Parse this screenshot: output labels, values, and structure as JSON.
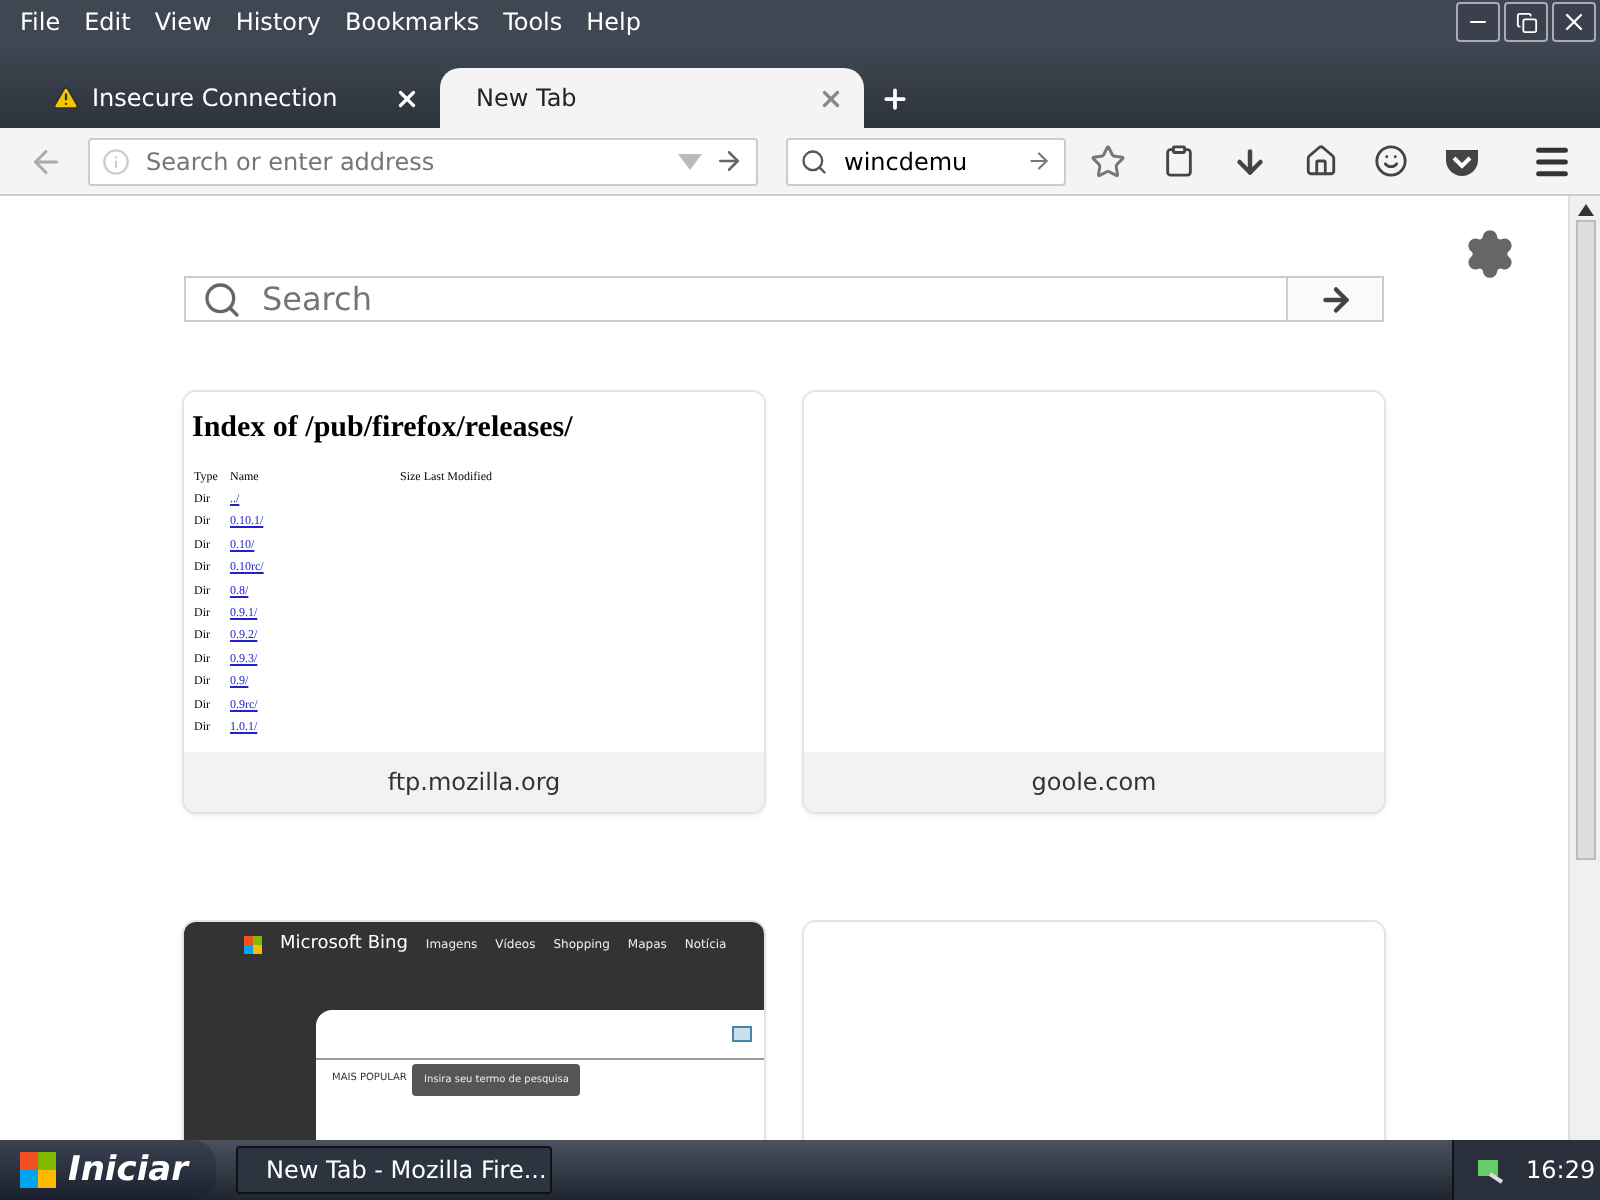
{
  "menu": [
    "File",
    "Edit",
    "View",
    "History",
    "Bookmarks",
    "Tools",
    "Help"
  ],
  "tabs": [
    {
      "label": "Insecure Connection",
      "selected": false,
      "warning": true
    },
    {
      "label": "New Tab",
      "selected": true,
      "warning": false
    }
  ],
  "address": {
    "placeholder": "Search or enter address"
  },
  "search_bar": {
    "value": "wincdemu"
  },
  "page_search": {
    "placeholder": "Search"
  },
  "tiles": [
    {
      "kind": "listing",
      "label": "ftp.mozilla.org",
      "title": "Index of /pub/firefox/releases/",
      "columns": [
        "Type",
        "Name",
        "Size Last Modified"
      ],
      "rows": [
        {
          "type": "Dir",
          "name": "../"
        },
        {
          "type": "Dir",
          "name": "0.10.1/"
        },
        {
          "type": "Dir",
          "name": "0.10/"
        },
        {
          "type": "Dir",
          "name": "0.10rc/"
        },
        {
          "type": "Dir",
          "name": "0.8/"
        },
        {
          "type": "Dir",
          "name": "0.9.1/"
        },
        {
          "type": "Dir",
          "name": "0.9.2/"
        },
        {
          "type": "Dir",
          "name": "0.9.3/"
        },
        {
          "type": "Dir",
          "name": "0.9/"
        },
        {
          "type": "Dir",
          "name": "0.9rc/"
        },
        {
          "type": "Dir",
          "name": "1.0.1/"
        }
      ]
    },
    {
      "kind": "blank",
      "label": "goole.com"
    },
    {
      "kind": "bing",
      "brand": "Microsoft Bing",
      "nav": [
        "Imagens",
        "Vídeos",
        "Shopping",
        "Mapas",
        "Notícia"
      ],
      "section": "MAIS POPULAR",
      "tooltip": "Insira seu termo de pesquisa"
    },
    {
      "kind": "blank"
    }
  ],
  "taskbar": {
    "start": "Iniciar",
    "task": "New Tab - Mozilla Fire...",
    "clock": "16:29"
  }
}
